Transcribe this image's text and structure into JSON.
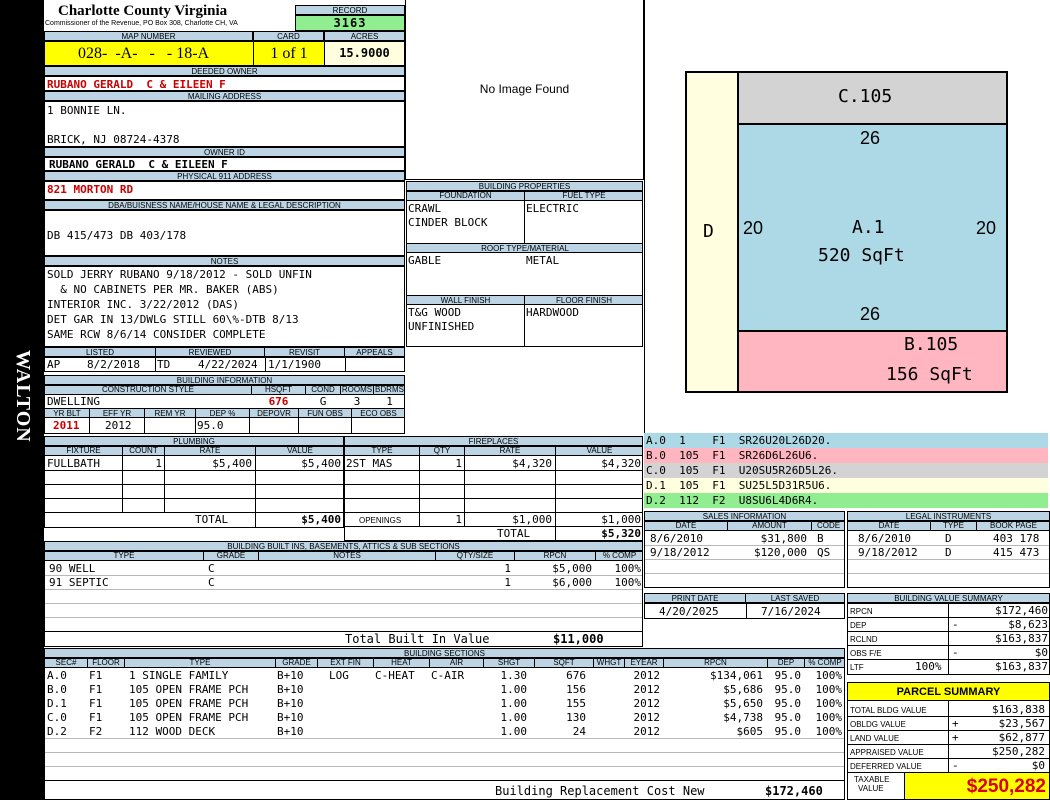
{
  "header": {
    "county": "Charlotte County Virginia",
    "commissioner": "Commissioner of the Revenue, PO Box 308, Charlotte CH, VA",
    "record_label": "RECORD",
    "record": "3163",
    "map_label": "MAP NUMBER",
    "map": "028-  -A-   -   - 18-A",
    "card_label": "CARD",
    "card": "1 of 1",
    "acres_label": "ACRES",
    "acres": "15.9000"
  },
  "owner": {
    "deeded_label": "DEEDED OWNER",
    "deeded": "RUBANO GERALD  C & EILEEN F",
    "mailing_label": "MAILING ADDRESS",
    "addr1": "1 BONNIE LN.",
    "addr2": "BRICK, NJ 08724-4378",
    "id_label": "OWNER ID",
    "owner_id": "RUBANO GERALD  C & EILEEN F",
    "phys_label": "PHYSICAL 911 ADDRESS",
    "phys": "821 MORTON RD",
    "dba_label": "DBA/BUISNESS NAME/HOUSE NAME & LEGAL DESCRIPTION",
    "dba": "DB 415/473 DB 403/178"
  },
  "photo": {
    "text": "No Image Found"
  },
  "notes": {
    "label": "NOTES",
    "lines": [
      "SOLD JERRY RUBANO 9/18/2012 - SOLD UNFIN",
      "  & NO CABINETS PER MR. BAKER (ABS)",
      "INTERIOR INC. 3/22/2012 (DAS)",
      "DET GAR IN 13/DWLG STILL 60\\%-DTB 8/13",
      "SAME RCW 8/6/14 CONSIDER COMPLETE"
    ]
  },
  "dates": {
    "listed_label": "LISTED",
    "listed_by": "AP",
    "listed": "8/2/2018",
    "reviewed_label": "REVIEWED",
    "reviewed_by": "TD",
    "reviewed": "4/22/2024",
    "revisit_label": "REVISIT",
    "revisit": "1/1/1900",
    "appeals_label": "APPEALS"
  },
  "building": {
    "label": "BUILDING INFORMATION",
    "style_label": "CONSTRUCTION STYLE",
    "hsqft_label": "HSQFT",
    "cond_label": "COND",
    "rooms_label": "ROOMS",
    "bdrms_label": "BDRMS",
    "style": "DWELLING",
    "hsqft": "676",
    "cond": "G",
    "rooms": "3",
    "bdrms": "1",
    "yrblt_label": "YR BLT",
    "effyr_label": "EFF YR",
    "remyr_label": "REM YR",
    "dep_label": "DEP %",
    "depovr_label": "DEPOVR",
    "funobs_label": "FUN OBS",
    "ecoobs_label": "ECO OBS",
    "yrblt": "2011",
    "effyr": "2012",
    "dep": "95.0"
  },
  "props": {
    "label": "BUILDING PROPERTIES",
    "foundation_label": "FOUNDATION",
    "fuel_label": "FUEL TYPE",
    "foundation": [
      "CRAWL",
      "CINDER BLOCK"
    ],
    "fuel": "ELECTRIC",
    "roof_label": "ROOF TYPE/MATERIAL",
    "roof_type": "GABLE",
    "roof_mat": "METAL",
    "wall_label": "WALL FINISH",
    "floor_label": "FLOOR FINISH",
    "wall": [
      "T&G WOOD",
      "UNFINISHED"
    ],
    "floor": "HARDWOOD"
  },
  "plumbing": {
    "label": "PLUMBING",
    "h_fixture": "FIXTURE",
    "h_count": "COUNT",
    "h_rate": "RATE",
    "h_value": "VALUE",
    "fixture": "FULLBATH",
    "count": "1",
    "rate": "$5,400",
    "value": "$5,400",
    "total_label": "TOTAL",
    "total": "$5,400"
  },
  "fireplaces": {
    "label": "FIREPLACES",
    "h_type": "TYPE",
    "h_qty": "QTY",
    "h_rate": "RATE",
    "h_value": "VALUE",
    "type": "2ST MAS",
    "qty": "1",
    "rate": "$4,320",
    "value": "$4,320",
    "open_label": "OPENINGS",
    "open_qty": "1",
    "open_rate": "$1,000",
    "open_value": "$1,000",
    "total_label": "TOTAL",
    "total": "$5,320"
  },
  "builtins": {
    "label": "BUILDING BUILT INS, BASEMENTS, ATTICS & SUB SECTIONS",
    "h_type": "TYPE",
    "h_grade": "GRADE",
    "h_notes": "NOTES",
    "h_qty": "QTY/SIZE",
    "h_rpcn": "RPCN",
    "h_comp": "% COMP",
    "rows": [
      {
        "type": "90 WELL",
        "grade": "C",
        "qty": "1",
        "rpcn": "$5,000",
        "comp": "100%"
      },
      {
        "type": "91 SEPTIC",
        "grade": "C",
        "qty": "1",
        "rpcn": "$6,000",
        "comp": "100%"
      }
    ],
    "total_label": "Total Built In Value",
    "total": "$11,000"
  },
  "sketch": {
    "c105": "C.105",
    "a1": "A.1",
    "a1_area": "520 SqFt",
    "b105": "B.105",
    "b105_area": "156 SqFt",
    "d": "D",
    "n26": "26",
    "n20": "20"
  },
  "sketch_legend": [
    {
      "text": "A.0  1    F1  SR26U20L26D20.",
      "color": "#add8e6"
    },
    {
      "text": "B.0  105  F1  SR26D6L26U6.",
      "color": "#ffb6c1"
    },
    {
      "text": "C.0  105  F1  U20SU5R26D5L26.",
      "color": "#d3d3d3"
    },
    {
      "text": "D.1  105  F1  SU25L5D31R5U6.",
      "color": "#ffffe0"
    },
    {
      "text": "D.2  112  F2  U8SU6L4D6R4.",
      "color": "#90ee90"
    }
  ],
  "sales": {
    "label": "SALES INFORMATION",
    "h_date": "DATE",
    "h_amount": "AMOUNT",
    "h_code": "CODE",
    "rows": [
      {
        "date": "8/6/2010",
        "amount": "$31,800",
        "code": "B"
      },
      {
        "date": "9/18/2012",
        "amount": "$120,000",
        "code": "QS"
      }
    ]
  },
  "legal": {
    "label": "LEGAL INSTRUMENTS",
    "h_date": "DATE",
    "h_type": "TYPE",
    "h_book": "BOOK PAGE",
    "rows": [
      {
        "date": "8/6/2010",
        "type": "D",
        "book": "403 178"
      },
      {
        "date": "9/18/2012",
        "type": "D",
        "book": "415 473"
      }
    ]
  },
  "print": {
    "print_label": "PRINT DATE",
    "print_date": "4/20/2025",
    "saved_label": "LAST SAVED",
    "saved": "7/16/2024"
  },
  "bvs": {
    "label": "BUILDING VALUE SUMMARY",
    "rows": [
      {
        "k": "RPCN",
        "s": "",
        "v": "$172,460"
      },
      {
        "k": "DEP",
        "s": "-",
        "v": "$8,623"
      },
      {
        "k": "RCLND",
        "s": "",
        "v": "$163,837"
      },
      {
        "k": "OBS F/E",
        "s": "-",
        "v": "$0"
      },
      {
        "k": "LTF",
        "p": "100%",
        "s": "",
        "v": "$163,837"
      }
    ]
  },
  "parcel": {
    "label": "PARCEL SUMMARY",
    "rows": [
      {
        "k": "TOTAL BLDG VALUE",
        "s": "",
        "v": "$163,838"
      },
      {
        "k": "OBLDG VALUE",
        "s": "+",
        "v": "$23,567"
      },
      {
        "k": "LAND VALUE",
        "s": "+",
        "v": "$62,877"
      },
      {
        "k": "APPRAISED VALUE",
        "s": "",
        "v": "$250,282"
      },
      {
        "k": "DEFERRED VALUE",
        "s": "-",
        "v": "$0"
      }
    ],
    "taxable_label1": "TAXABLE",
    "taxable_label2": "VALUE",
    "taxable": "$250,282"
  },
  "sections": {
    "label": "BUILDING SECTIONS",
    "headers": [
      "SEC#",
      "FLOOR",
      "TYPE",
      "GRADE",
      "EXT FIN",
      "HEAT",
      "AIR",
      "SHGT",
      "SQFT",
      "WHGT",
      "EYEAR",
      "RPCN",
      "DEP",
      "% COMP"
    ],
    "rows": [
      [
        "A.0",
        "F1",
        "1 SINGLE FAMILY",
        "B+10",
        "LOG",
        "C-HEAT",
        "C-AIR",
        "1.30",
        "676",
        "",
        "2012",
        "$134,061",
        "95.0",
        "100%"
      ],
      [
        "B.0",
        "F1",
        "105 OPEN FRAME PCH",
        "B+10",
        "",
        "",
        "",
        "1.00",
        "156",
        "",
        "2012",
        "$5,686",
        "95.0",
        "100%"
      ],
      [
        "D.1",
        "F1",
        "105 OPEN FRAME PCH",
        "B+10",
        "",
        "",
        "",
        "1.00",
        "155",
        "",
        "2012",
        "$5,650",
        "95.0",
        "100%"
      ],
      [
        "C.0",
        "F1",
        "105 OPEN FRAME PCH",
        "B+10",
        "",
        "",
        "",
        "1.00",
        "130",
        "",
        "2012",
        "$4,738",
        "95.0",
        "100%"
      ],
      [
        "D.2",
        "F2",
        "112 WOOD DECK",
        "B+10",
        "",
        "",
        "",
        "1.00",
        "24",
        "",
        "2012",
        "$605",
        "95.0",
        "100%"
      ]
    ],
    "brc_label": "Building Replacement Cost New",
    "brc": "$172,460"
  },
  "side": {
    "text": "WALTON"
  }
}
